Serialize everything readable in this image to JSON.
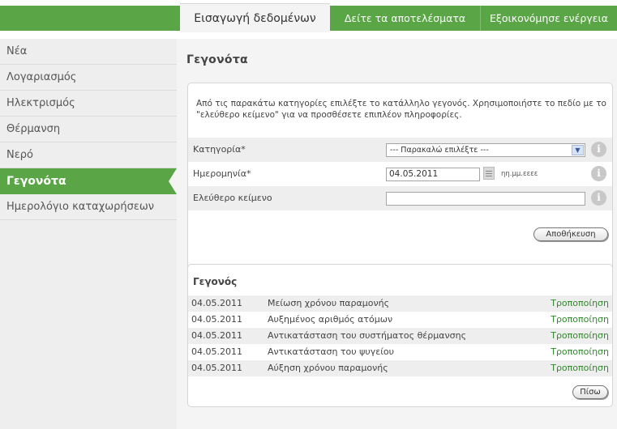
{
  "nav": {
    "tabs": [
      {
        "label": "Εισαγωγή δεδομένων"
      },
      {
        "label": "Δείτε τα αποτελέσματα"
      },
      {
        "label": "Εξοικονόμησε ενέργεια"
      }
    ]
  },
  "sidebar": {
    "items": [
      {
        "label": "Νέα"
      },
      {
        "label": "Λογαριασμός"
      },
      {
        "label": "Ηλεκτρισμός"
      },
      {
        "label": "Θέρμανση"
      },
      {
        "label": "Νερό"
      },
      {
        "label": "Γεγονότα"
      },
      {
        "label": "Ημερολόγιο καταχωρήσεων"
      }
    ]
  },
  "page": {
    "title": "Γεγονότα",
    "intro": "Από τις παρακάτω κατηγορίες επιλέξτε το κατάλληλο γεγονός. Χρησιμοποιήστε το πεδίο με το \"ελεύθερο κείμενο\" για να προσθέσετε επιπλέον πληροφορίες."
  },
  "form": {
    "category_label": "Κατηγορία*",
    "category_value": "--- Παρακαλώ επιλέξτε ---",
    "date_label": "Ημερομηνία*",
    "date_value": "04.05.2011",
    "date_hint": "ηη.μμ.εεεε",
    "freetext_label": "Ελεύθερο κείμενο",
    "freetext_value": "",
    "info_glyph": "i",
    "save_label": "Αποθήκευση"
  },
  "events": {
    "header": "Γεγονός",
    "rows": [
      {
        "date": "04.05.2011",
        "text": "Μείωση χρόνου παραμονής",
        "action": "Τροποποίηση"
      },
      {
        "date": "04.05.2011",
        "text": "Αυξημένος αριθμός ατόμων",
        "action": "Τροποποίηση"
      },
      {
        "date": "04.05.2011",
        "text": "Αντικατάσταση του συστήματος θέρμανσης",
        "action": "Τροποποίηση"
      },
      {
        "date": "04.05.2011",
        "text": "Αντικατάσταση του ψυγείου",
        "action": "Τροποποίηση"
      },
      {
        "date": "04.05.2011",
        "text": "Αύξηση χρόνου παραμονής",
        "action": "Τροποποίηση"
      }
    ],
    "back_label": "Πίσω"
  },
  "colors": {
    "brand_green": "#5aa545",
    "link_green": "#2f8a2a"
  }
}
